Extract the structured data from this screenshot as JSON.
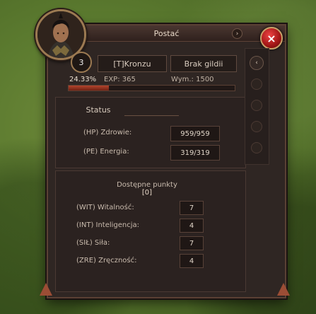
{
  "window": {
    "title": "Postać"
  },
  "character": {
    "level": "3",
    "name": "[T]Kronzu",
    "guild": "Brak gildii"
  },
  "experience": {
    "percent_text": "24.33%",
    "exp_label": "EXP: 365",
    "required_label": "Wym.: 1500",
    "progress_fraction": 0.2433
  },
  "status": {
    "title": "Status",
    "rows": [
      {
        "label": "(HP) Zdrowie:",
        "value": "959/959"
      },
      {
        "label": "(PE) Energia:",
        "value": "319/319"
      }
    ]
  },
  "points": {
    "label": "Dostępne punkty",
    "value": "[0]"
  },
  "attributes": [
    {
      "label": "(WIT) Witalność:",
      "value": "7"
    },
    {
      "label": "(INT) Inteligencja:",
      "value": "4"
    },
    {
      "label": "(SIŁ) Siła:",
      "value": "7"
    },
    {
      "label": "(ZRE) Zręczność:",
      "value": "4"
    }
  ],
  "icons": {
    "close": "close-icon",
    "title_arrow": "chevron-right-icon",
    "sidebar_top": "chevron-left-icon"
  },
  "colors": {
    "xp_fill": "#b2452d",
    "close_red": "#a01515"
  }
}
